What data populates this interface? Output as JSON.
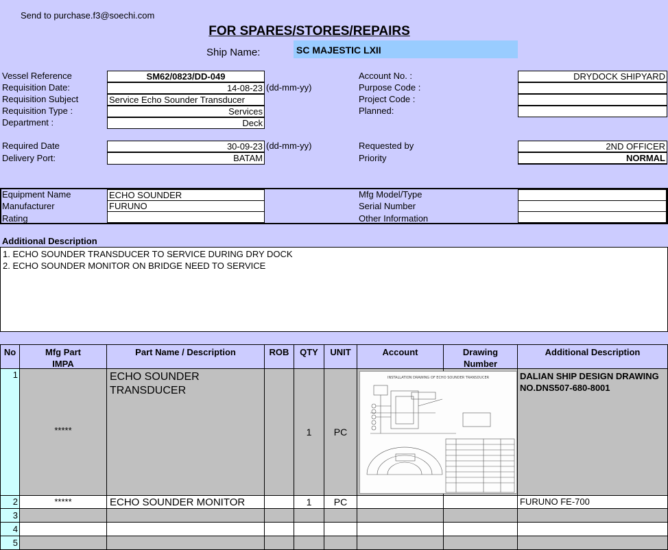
{
  "header": {
    "send_to": "Send to purchase.f3@soechi.com",
    "title": "FOR SPARES/STORES/REPAIRS",
    "ship_name_label": "Ship Name:",
    "ship_name": "SC MAJESTIC LXII"
  },
  "requisition": {
    "vessel_reference_label": "Vessel Reference",
    "vessel_reference": "SM62/0823/DD-049",
    "requisition_date_label": "Requisition Date:",
    "requisition_date": "14-08-23",
    "date_format": "(dd-mm-yy)",
    "requisition_subject_label": "Requisition Subject",
    "requisition_subject": "Service Echo Sounder Transducer",
    "requisition_type_label": "Requisition Type :",
    "requisition_type": "Services",
    "department_label": "Department :",
    "department": "Deck",
    "account_no_label": "Account No. :",
    "account_no": "DRYDOCK SHIPYARD",
    "purpose_code_label": "Purpose Code :",
    "purpose_code": "",
    "project_code_label": "Project Code :",
    "project_code": "",
    "planned_label": "Planned:",
    "planned": "",
    "required_date_label": "Required Date",
    "required_date": "30-09-23",
    "required_date_format": "(dd-mm-yy)",
    "delivery_port_label": "Delivery Port:",
    "delivery_port": "BATAM",
    "requested_by_label": "Requested by",
    "requested_by": "2ND OFFICER",
    "priority_label": "Priority",
    "priority": "NORMAL"
  },
  "equipment": {
    "name_label": "Equipment Name",
    "name": "ECHO SOUNDER",
    "manufacturer_label": "Manufacturer",
    "manufacturer": "FURUNO",
    "rating_label": "Rating",
    "rating": "",
    "model_label": "Mfg Model/Type",
    "model": "",
    "serial_label": "Serial Number",
    "serial": "",
    "other_label": "Other Information",
    "other": ""
  },
  "additional_description": {
    "label": "Additional Description",
    "lines": [
      "1. ECHO SOUNDER TRANSDUCER TO SERVICE DURING DRY DOCK",
      "2. ECHO SOUNDER MONITOR ON BRIDGE NEED TO SERVICE"
    ]
  },
  "table": {
    "headers": {
      "no": "No",
      "mfg_part_1": "Mfg Part",
      "mfg_part_2": "IMPA",
      "part_name": "Part Name / Description",
      "rob": "ROB",
      "qty": "QTY",
      "unit": "UNIT",
      "account": "Account",
      "drawing_1": "Drawing",
      "drawing_2": "Number",
      "additional": "Additional Description"
    },
    "rows": [
      {
        "no": "1",
        "mfg": "*****",
        "name": "ECHO SOUNDER TRANSDUCER",
        "rob": "",
        "qty": "1",
        "unit": "PC",
        "account": "",
        "drawing": "",
        "additional": "DALIAN SHIP DESIGN DRAWING NO.DNS507-680-8001",
        "drawing_image_title": "INSTALLATION DRAWING OF ECHO SOUNDER TRANSDUCER"
      },
      {
        "no": "2",
        "mfg": "*****",
        "name": "ECHO SOUNDER MONITOR",
        "rob": "",
        "qty": "1",
        "unit": "PC",
        "account": "",
        "drawing": "",
        "additional": "FURUNO FE-700"
      },
      {
        "no": "3"
      },
      {
        "no": "4"
      },
      {
        "no": "5"
      }
    ]
  }
}
